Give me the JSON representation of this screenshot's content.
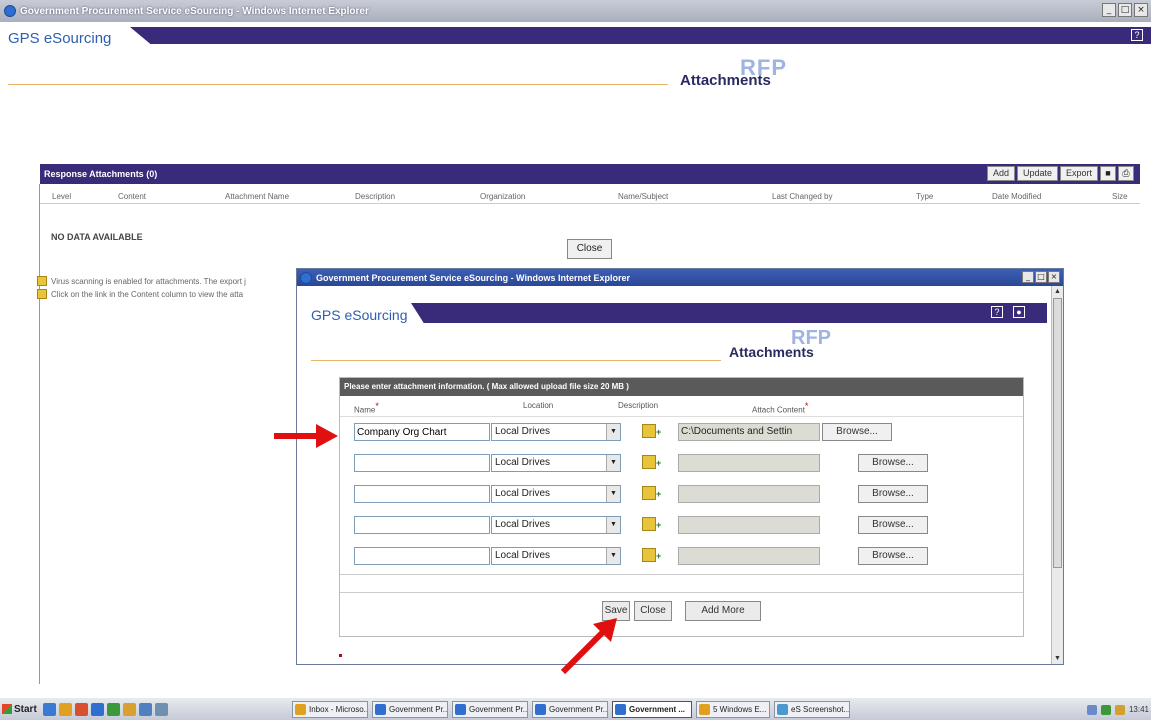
{
  "browser": {
    "title": "Government Procurement Service eSourcing - Windows Internet Explorer",
    "controls": [
      "_",
      "□",
      "×"
    ]
  },
  "app": {
    "brand": "GPS eSourcing",
    "page_title": "Attachments",
    "rfp_label": "RFP"
  },
  "responses": {
    "title": "Response Attachments (0)",
    "actions": [
      "Add",
      "Update",
      "Export"
    ],
    "columns": [
      "Level",
      "Content",
      "Attachment Name",
      "Description",
      "Organization",
      "Name/Subject",
      "Last Changed by",
      "Type",
      "Date Modified",
      "Size"
    ],
    "empty_text": "NO DATA AVAILABLE",
    "close_label": "Close",
    "info_lines": [
      "Virus scanning is enabled for attachments. The export j",
      "Click on the link in the Content column to view the atta"
    ]
  },
  "popup": {
    "title": "Government Procurement Service eSourcing - Windows Internet Explorer",
    "brand": "GPS eSourcing",
    "page_title": "Attachments",
    "rfp_label": "RFP",
    "form_header": "Please enter attachment information. ( Max allowed upload file size 20 MB )",
    "col_name": "Name",
    "col_location": "Location",
    "col_description": "Description",
    "col_attach": "Attach Content",
    "rows": [
      {
        "name": "Company Org Chart",
        "location": "Local Drives",
        "attach": "C:\\Documents and Settin",
        "browse": "Browse..."
      },
      {
        "name": "",
        "location": "Local Drives",
        "attach": "",
        "browse": "Browse..."
      },
      {
        "name": "",
        "location": "Local Drives",
        "attach": "",
        "browse": "Browse..."
      },
      {
        "name": "",
        "location": "Local Drives",
        "attach": "",
        "browse": "Browse..."
      },
      {
        "name": "",
        "location": "Local Drives",
        "attach": "",
        "browse": "Browse..."
      }
    ],
    "buttons": {
      "save": "Save",
      "close": "Close",
      "add_more": "Add More"
    }
  },
  "taskbar": {
    "start": "Start",
    "items": [
      "Inbox - Microso...",
      "Government Pr...",
      "Government Pr...",
      "Government Pr...",
      "Government ...",
      "5 Windows E...",
      "eS Screenshot..."
    ],
    "active_index": 4,
    "clock": "13:41"
  },
  "colors": {
    "header_purple": "#3a2a7a",
    "brand_blue": "#2d5fb0",
    "annotation_red": "#e01010",
    "accent_orange": "#e8b46a"
  }
}
